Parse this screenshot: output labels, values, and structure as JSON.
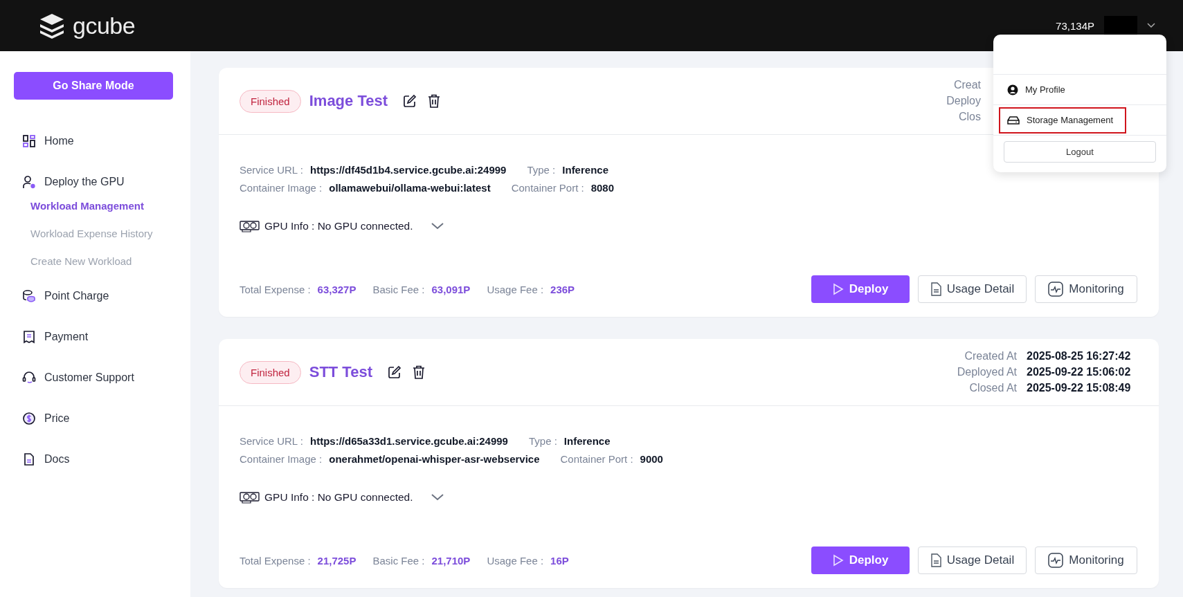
{
  "header": {
    "logo": "gcube",
    "points": "73,134P"
  },
  "account_menu": {
    "items": [
      {
        "label": "My Profile",
        "highlighted": false
      },
      {
        "label": "Storage Management",
        "highlighted": true
      }
    ],
    "logout": "Logout"
  },
  "sidebar": {
    "share_button": "Go Share Mode",
    "items": [
      {
        "label": "Home"
      },
      {
        "label": "Deploy the GPU",
        "children": [
          {
            "label": "Workload Management",
            "selected": true
          },
          {
            "label": "Workload Expense History",
            "selected": false
          },
          {
            "label": "Create New Workload",
            "selected": false
          }
        ]
      },
      {
        "label": "Point Charge"
      },
      {
        "label": "Payment"
      },
      {
        "label": "Customer Support"
      },
      {
        "label": "Price"
      },
      {
        "label": "Docs"
      }
    ]
  },
  "workloads": [
    {
      "status": "Finished",
      "name": "Image Test",
      "meta": [
        {
          "label": "Creat"
        },
        {
          "label": "Deploy"
        },
        {
          "label": "Clos"
        }
      ],
      "details": [
        [
          {
            "label": "Service URL :",
            "value": "https://df45d1b4.service.gcube.ai:24999"
          },
          {
            "label": "Type :",
            "value": "Inference"
          }
        ],
        [
          {
            "label": "Container Image :",
            "value": "ollamawebui/ollama-webui:latest"
          },
          {
            "label": "Container Port :",
            "value": "8080"
          }
        ]
      ],
      "gpu_info": "GPU Info : No GPU connected.",
      "fees": [
        {
          "label": "Total Expense :",
          "value": "63,327P"
        },
        {
          "label": "Basic Fee :",
          "value": "63,091P"
        },
        {
          "label": "Usage Fee :",
          "value": "236P"
        }
      ],
      "buttons": [
        {
          "label": "Deploy",
          "kind": "primary"
        },
        {
          "label": "Usage Detail",
          "kind": "usage"
        },
        {
          "label": "Monitoring",
          "kind": "monitor"
        }
      ]
    },
    {
      "status": "Finished",
      "name": "STT Test",
      "meta": [
        {
          "label": "Created At",
          "value": "2025-08-25 16:27:42"
        },
        {
          "label": "Deployed At",
          "value": "2025-09-22 15:06:02"
        },
        {
          "label": "Closed At",
          "value": "2025-09-22 15:08:49"
        }
      ],
      "details": [
        [
          {
            "label": "Service URL :",
            "value": "https://d65a33d1.service.gcube.ai:24999"
          },
          {
            "label": "Type :",
            "value": "Inference"
          }
        ],
        [
          {
            "label": "Container Image :",
            "value": "onerahmet/openai-whisper-asr-webservice"
          },
          {
            "label": "Container Port :",
            "value": "9000"
          }
        ]
      ],
      "gpu_info": "GPU Info : No GPU connected.",
      "fees": [
        {
          "label": "Total Expense :",
          "value": "21,725P"
        },
        {
          "label": "Basic Fee :",
          "value": "21,710P"
        },
        {
          "label": "Usage Fee :",
          "value": "16P"
        }
      ],
      "buttons": [
        {
          "label": "Deploy",
          "kind": "primary"
        },
        {
          "label": "Usage Detail",
          "kind": "usage"
        },
        {
          "label": "Monitoring",
          "kind": "monitor"
        }
      ]
    }
  ]
}
